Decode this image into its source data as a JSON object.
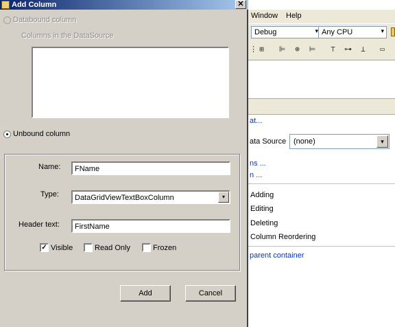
{
  "dialog": {
    "title": "Add Column",
    "close_glyph": "✕",
    "databound_label": "Databound column",
    "columns_label": "Columns in the DataSource",
    "unbound_label": "Unbound column",
    "name_label": "Name:",
    "name_value": "FName",
    "type_label": "Type:",
    "type_value": "DataGridViewTextBoxColumn",
    "header_label": "Header text:",
    "header_value": "FirstName",
    "visible_label": "Visible",
    "visible_checked": true,
    "readonly_label": "Read Only",
    "readonly_checked": false,
    "frozen_label": "Frozen",
    "frozen_checked": false,
    "add_label": "Add",
    "cancel_label": "Cancel",
    "check_glyph": "✓"
  },
  "ide": {
    "menu": [
      "Window",
      "Help"
    ],
    "config_value": "Debug",
    "platform_value": "Any CPU",
    "dropdown_glyph": "▾",
    "tasks": {
      "link1": "at...",
      "datasource_label": "ata Source",
      "datasource_value": "(none)",
      "link2": "ns ...",
      "link3": "n ...",
      "opt_adding": "Adding",
      "opt_editing": "Editing",
      "opt_deleting": "Deleting",
      "opt_reorder": "Column Reordering",
      "dock_link": "parent container"
    }
  }
}
